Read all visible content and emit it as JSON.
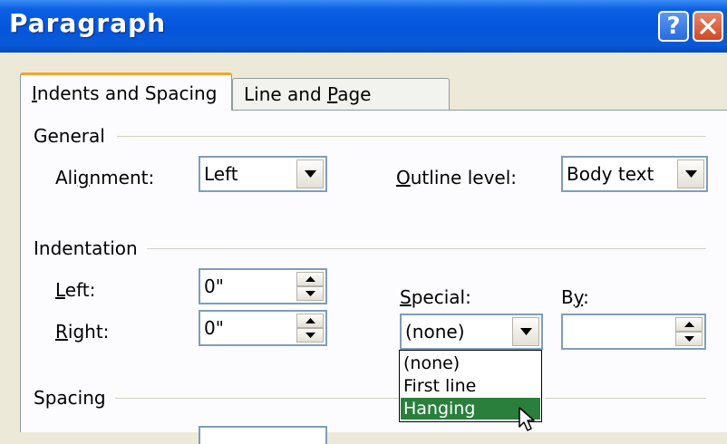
{
  "window": {
    "title": "Paragraph",
    "help_label": "?",
    "close_icon": "close-icon"
  },
  "tabs": [
    {
      "label": "Indents and Spacing",
      "accel": "I",
      "active": true
    },
    {
      "label": "Line and Page Breaks",
      "accel": "P",
      "active": false
    }
  ],
  "general": {
    "section": "General",
    "alignment_label": "Alignment:",
    "alignment_accel": "g",
    "alignment_value": "Left",
    "outline_label": "Outline level:",
    "outline_accel": "O",
    "outline_value": "Body text"
  },
  "indentation": {
    "section": "Indentation",
    "left_label": "Left:",
    "left_accel": "L",
    "left_value": "0\"",
    "right_label": "Right:",
    "right_accel": "R",
    "right_value": "0\"",
    "special_label": "Special:",
    "special_accel": "S",
    "special_value": "(none)",
    "by_label": "By:",
    "by_accel": "y",
    "by_value": ""
  },
  "special_options": [
    {
      "label": "(none)",
      "selected": false
    },
    {
      "label": "First line",
      "selected": false
    },
    {
      "label": "Hanging",
      "selected": true
    }
  ],
  "spacing": {
    "section": "Spacing"
  },
  "colors": {
    "title_bar": "#0555dc",
    "tab_highlight": "#f3a52a",
    "selected_option": "#2a7f3c"
  }
}
